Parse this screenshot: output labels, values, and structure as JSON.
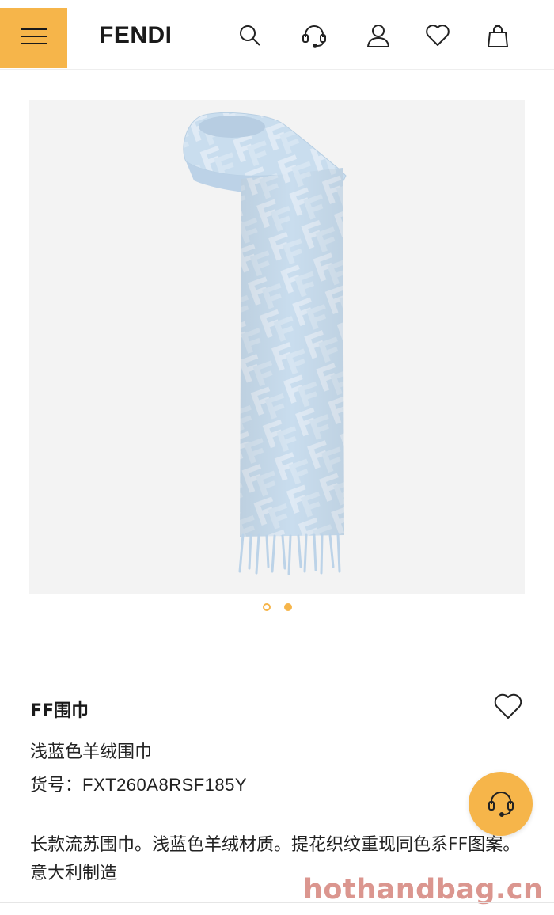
{
  "header": {
    "brand": "FENDI",
    "icons": [
      "menu-icon",
      "search-icon",
      "headset-icon",
      "user-icon",
      "heart-icon",
      "shopping-bag-icon"
    ]
  },
  "gallery": {
    "image": "light-blue-ff-scarf",
    "slide_count": 2,
    "active_slide": 2
  },
  "product": {
    "title": "FF围巾",
    "subtitle": "浅蓝色羊绒围巾",
    "sku_label": "货号：",
    "sku_value": "FXT260A8RSF185Y",
    "description": "长款流苏围巾。浅蓝色羊绒材质。提花织纹重现同色系FF图案。意大利制造"
  },
  "watermark": "hothandbag.cn",
  "colors": {
    "accent": "#f6b54a",
    "scarf": "#c9ddee",
    "background": "#ffffff",
    "text": "#222222",
    "watermark": "#cd6e64"
  }
}
